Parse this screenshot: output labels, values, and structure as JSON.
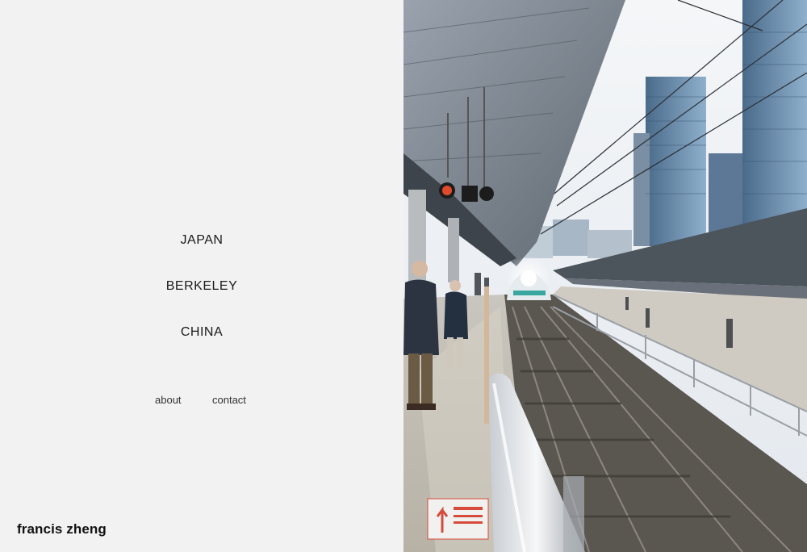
{
  "nav": {
    "items": [
      {
        "label": "JAPAN"
      },
      {
        "label": "BERKELEY"
      },
      {
        "label": "CHINA"
      }
    ]
  },
  "secondary_nav": {
    "about_label": "about",
    "contact_label": "contact"
  },
  "site": {
    "name": "francis zheng"
  },
  "colors": {
    "background": "#f2f2f2",
    "text": "#1a1a1a"
  },
  "hero_image": {
    "signal_lights": [
      "red",
      "off",
      "off"
    ]
  }
}
